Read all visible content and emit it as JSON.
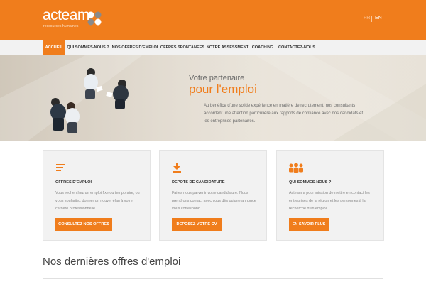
{
  "header": {
    "logo_word": "acteam",
    "logo_tagline": "ressources humaines",
    "lang_fr": "FR",
    "lang_en": "EN"
  },
  "nav": {
    "items": [
      {
        "label": "ACCUEIL",
        "active": true
      },
      {
        "label": "QUI SOMMES-NOUS ?",
        "active": false
      },
      {
        "label": "NOS OFFRES D'EMPLOI",
        "active": false
      },
      {
        "label": "OFFRES SPONTANÉES",
        "active": false
      },
      {
        "label": "NOTRE ASSESSMENT",
        "active": false
      },
      {
        "label": "COACHING",
        "active": false
      },
      {
        "label": "CONTACTEZ-NOUS",
        "active": false
      }
    ]
  },
  "hero": {
    "line1": "Votre partenaire",
    "line2": "pour l'emploi",
    "text": "Au bénéfice d'une solide expérience en matière de recrutement, nos consultants accordent une attention particulière aux rapports de confiance avec nos candidats et les entreprises partenaires."
  },
  "cards": [
    {
      "icon": "list-icon",
      "title": "OFFRES D'EMPLOI",
      "text": "Vous recherchez un emploi fixe ou temporaire, ou vous souhaitez donner un nouvel élan à votre carrière professionnelle.",
      "button": "CONSULTEZ NOS OFFRES"
    },
    {
      "icon": "download-icon",
      "title": "DÉPÔTS DE CANDIDATURE",
      "text": "Faites nous parvenir votre candidature. Nous prendrons contact avec vous dès qu'une annonce vous correspond.",
      "button": "DÉPOSEZ VOTRE CV"
    },
    {
      "icon": "team-icon",
      "title": "QUI SOMMES-NOUS ?",
      "text": "Acteam a pour mission de mettre en contact les entreprises de la région et les personnes à la recherche d'un emploi.",
      "button": "EN SAVOIR PLUS"
    }
  ],
  "section": {
    "title": "Nos dernières offres d'emploi"
  },
  "colors": {
    "accent": "#f07d1c",
    "nav_bg": "#f2f2f2",
    "card_bg": "#f2f2f2"
  }
}
